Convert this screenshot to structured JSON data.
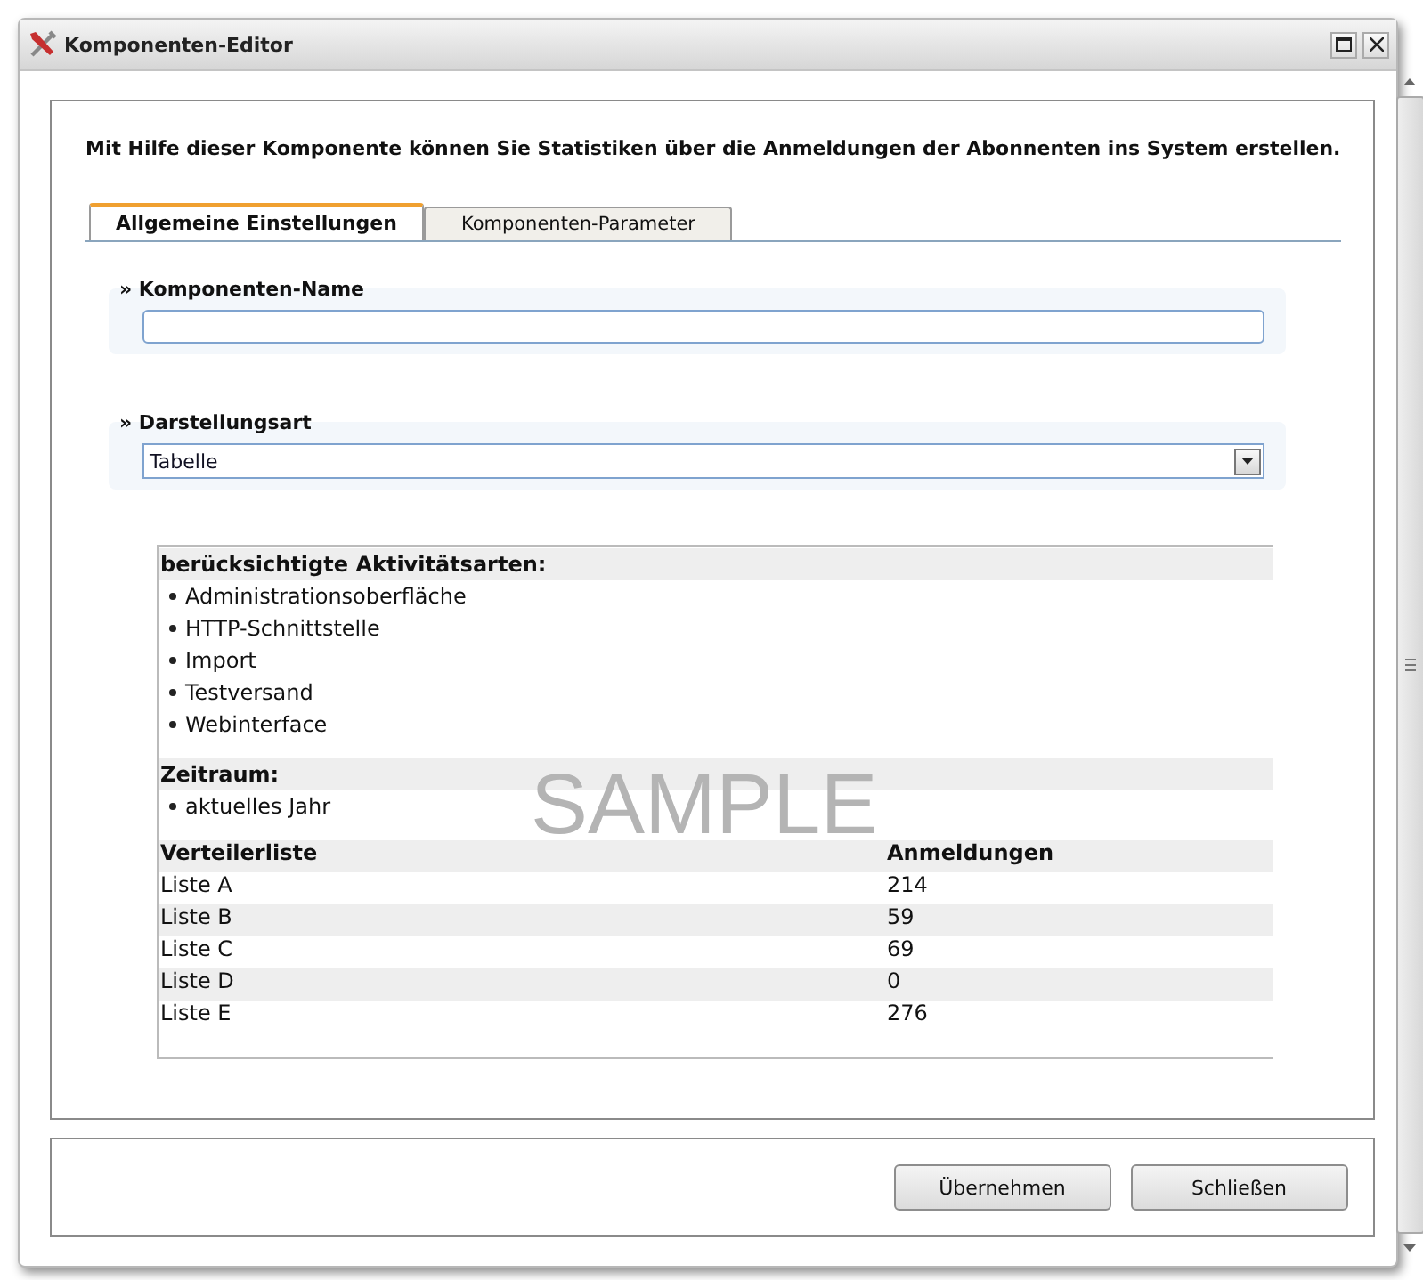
{
  "window": {
    "title": "Komponenten-Editor"
  },
  "intro": "Mit Hilfe dieser Komponente können Sie Statistiken über die Anmeldungen der Abonnenten ins System erstellen.",
  "tabs": [
    {
      "label": "Allgemeine Einstellungen",
      "selected": true
    },
    {
      "label": "Komponenten-Parameter",
      "selected": false
    }
  ],
  "fields": [
    {
      "kind": "text",
      "label": "» Komponenten-Name"
    },
    {
      "kind": "select",
      "label": "» Darstellungsart",
      "value": "Tabelle"
    }
  ],
  "preview": {
    "watermark": "SAMPLE",
    "sections": [
      {
        "heading": "berücksichtigte Aktivitätsarten:",
        "items": [
          "Administrationsoberfläche",
          "HTTP-Schnittstelle",
          "Import",
          "Testversand",
          "Webinterface"
        ]
      },
      {
        "heading": "Zeitraum:",
        "items": [
          "aktuelles Jahr"
        ]
      }
    ],
    "table": {
      "columns": [
        "Verteilerliste",
        "Anmeldungen"
      ],
      "rows": [
        [
          "Liste A",
          "214"
        ],
        [
          "Liste B",
          "59"
        ],
        [
          "Liste C",
          "69"
        ],
        [
          "Liste D",
          "0"
        ],
        [
          "Liste E",
          "276"
        ]
      ]
    }
  },
  "buttons": [
    "Übernehmen",
    "Schließen"
  ]
}
